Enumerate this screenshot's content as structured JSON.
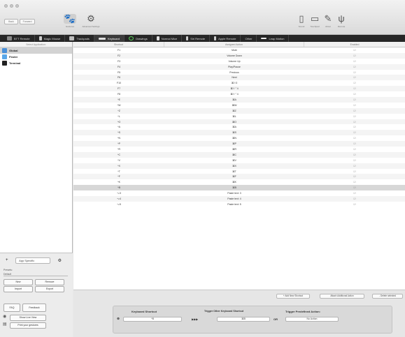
{
  "toolbar": {
    "back_label": "Back",
    "fwd_label": "Forward",
    "tools": [
      {
        "icon": "gestures-icon",
        "label": "Gestures",
        "glyph": "🐾"
      },
      {
        "icon": "advanced-settings-icon",
        "label": "Advanced Settings",
        "glyph": "⚙"
      }
    ],
    "right_tools": [
      {
        "icon": "sound-icon",
        "label": "Sound",
        "glyph": "▯"
      },
      {
        "icon": "touchpad-icon",
        "label": "Touchpad",
        "glyph": "▭"
      },
      {
        "icon": "about-icon",
        "label": "About",
        "glyph": "✎"
      },
      {
        "icon": "remote-icon",
        "label": "Remote",
        "glyph": "ψ"
      }
    ]
  },
  "categories": [
    {
      "label": "BTT Remote",
      "active": false
    },
    {
      "label": "Magic Mouse",
      "active": false
    },
    {
      "label": "Trackpads",
      "active": false
    },
    {
      "label": "Keyboard",
      "active": true
    },
    {
      "label": "Drawings",
      "active": false
    },
    {
      "label": "Normal Mice",
      "active": false
    },
    {
      "label": "Siri Remote",
      "active": false
    },
    {
      "label": "Apple Remote",
      "active": false
    },
    {
      "label": "Other",
      "active": false
    },
    {
      "label": "Leap Motion",
      "active": false
    }
  ],
  "sidebar": {
    "header": "Select Application:",
    "apps": [
      {
        "name": "Global",
        "selected": true,
        "color": "#4a90d9"
      },
      {
        "name": "Finder",
        "selected": false,
        "color": "#5aa7e8"
      },
      {
        "name": "Terminal",
        "selected": false,
        "color": "#222222"
      }
    ],
    "app_specific_label": "App Specific",
    "presets_label": "Presets:",
    "preset_value": "Default",
    "new_label": "New",
    "remove_label": "Remove",
    "import_label": "Import",
    "export_label": "Export",
    "faq_label": "FAQ",
    "feedback_label": "Feedback",
    "show_live_view_label": "Show Live View",
    "print_label": "Print your gestures"
  },
  "table": {
    "headers": [
      "Shortcut",
      "Assigned Action",
      "Enabled"
    ],
    "rows": [
      {
        "shortcut": "F1",
        "action": "Mute",
        "enabled": "☑"
      },
      {
        "shortcut": "F2",
        "action": "Volume Down",
        "enabled": "☑"
      },
      {
        "shortcut": "F3",
        "action": "Volume Up",
        "enabled": "☑"
      },
      {
        "shortcut": "F4",
        "action": "Play/Pause",
        "enabled": "☑"
      },
      {
        "shortcut": "F5",
        "action": "Previous",
        "enabled": "☑"
      },
      {
        "shortcut": "F6",
        "action": "Next",
        "enabled": "☑"
      },
      {
        "shortcut": "F10",
        "action": "⌘⇧3",
        "enabled": "☑"
      },
      {
        "shortcut": "F7",
        "action": "⌘⇧⌃4",
        "enabled": "☑"
      },
      {
        "shortcut": "F8",
        "action": "⌘⇧⌃4",
        "enabled": "☑"
      },
      {
        "shortcut": "^E",
        "action": "⌘A",
        "enabled": "☑"
      },
      {
        "shortcut": "^W",
        "action": "⌘W",
        "enabled": "☑"
      },
      {
        "shortcut": "^Z",
        "action": "⌘Z",
        "enabled": "☑"
      },
      {
        "shortcut": "^L",
        "action": "⌘L",
        "enabled": "☑"
      },
      {
        "shortcut": "^O",
        "action": "⌘O",
        "enabled": "☑"
      },
      {
        "shortcut": "^A",
        "action": "⌘A",
        "enabled": "☑"
      },
      {
        "shortcut": "^S",
        "action": "⌘S",
        "enabled": "☑"
      },
      {
        "shortcut": "^N",
        "action": "⌘N",
        "enabled": "☑"
      },
      {
        "shortcut": "^P",
        "action": "⌘P",
        "enabled": "☑"
      },
      {
        "shortcut": "^R",
        "action": "⌘R",
        "enabled": "☑"
      },
      {
        "shortcut": "^C",
        "action": "⌘C",
        "enabled": "☑"
      },
      {
        "shortcut": "^V",
        "action": "⌘V",
        "enabled": "☑"
      },
      {
        "shortcut": "^X",
        "action": "⌘X",
        "enabled": "☑"
      },
      {
        "shortcut": "^T",
        "action": "⌘T",
        "enabled": "☑"
      },
      {
        "shortcut": "^F",
        "action": "⌘F",
        "enabled": "☑"
      },
      {
        "shortcut": "^K",
        "action": "⌘K",
        "enabled": "☑"
      },
      {
        "shortcut": "^B",
        "action": "⌘B",
        "enabled": "☑"
      },
      {
        "shortcut": "⌥3",
        "action": "Paste text: 3",
        "enabled": "☑"
      },
      {
        "shortcut": "⌥4",
        "action": "Paste text: 4",
        "enabled": "☑"
      },
      {
        "shortcut": "⌥5",
        "action": "Paste text: 5",
        "enabled": "☑"
      }
    ],
    "selected_index": 25
  },
  "actions": {
    "add_label": "+ Add New Shortcut",
    "attach_label": "Attach Additional Action",
    "delete_label": "- Delete selected"
  },
  "config": {
    "shortcut_heading": "Keyboard Shortcut",
    "shortcut_value": "^B",
    "trigger_heading": "Trigger Other Keyboard Shortcut",
    "trigger_value": "⌘B",
    "arrow": "▶▶▶",
    "or_label": "OR",
    "predefined_heading": "Trigger Predefined Action:",
    "predefined_value": "No Action"
  }
}
